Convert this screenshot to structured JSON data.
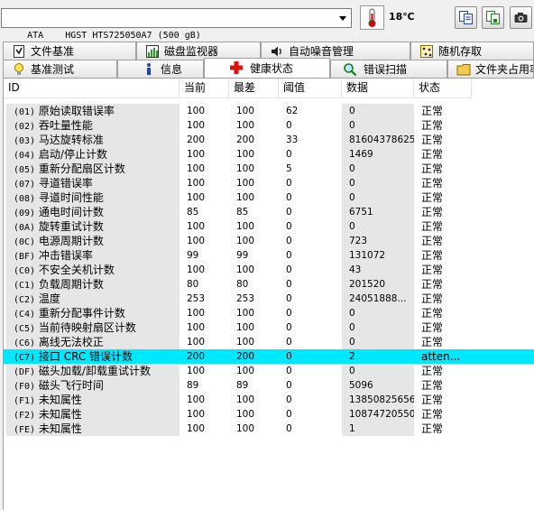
{
  "toolbar": {
    "drive": "ATA    HGST HTS725050A7 (500 gB)",
    "temperature": "18℃"
  },
  "tabs_row1": [
    {
      "label": "文件基准",
      "icon": "file-benchmark-icon"
    },
    {
      "label": "磁盘监视器",
      "icon": "disk-monitor-icon"
    },
    {
      "label": "自动噪音管理",
      "icon": "speaker-icon"
    },
    {
      "label": "随机存取",
      "icon": "random-access-icon"
    }
  ],
  "tabs_row2": [
    {
      "label": "基准测试",
      "icon": "lightbulb-icon"
    },
    {
      "label": "信息",
      "icon": "info-icon"
    },
    {
      "label": "健康状态",
      "icon": "red-cross-icon",
      "active": true
    },
    {
      "label": "错误扫描",
      "icon": "magnifier-icon"
    },
    {
      "label": "文件夹占用率",
      "icon": "folder-icon"
    }
  ],
  "table": {
    "headers": [
      "ID",
      "当前",
      "最差",
      "阈值",
      "数据",
      "状态"
    ],
    "selected_row": 17,
    "rows": [
      {
        "id": "(01)",
        "name": "原始读取错误率",
        "cur": "100",
        "worst": "100",
        "thresh": "62",
        "data": "0",
        "status": "正常"
      },
      {
        "id": "(02)",
        "name": "吞吐量性能",
        "cur": "100",
        "worst": "100",
        "thresh": "0",
        "data": "0",
        "status": "正常"
      },
      {
        "id": "(03)",
        "name": "马达旋转标准",
        "cur": "200",
        "worst": "200",
        "thresh": "33",
        "data": "81604378625",
        "status": "正常"
      },
      {
        "id": "(04)",
        "name": "启动/停止计数",
        "cur": "100",
        "worst": "100",
        "thresh": "0",
        "data": "1469",
        "status": "正常"
      },
      {
        "id": "(05)",
        "name": "重新分配扇区计数",
        "cur": "100",
        "worst": "100",
        "thresh": "5",
        "data": "0",
        "status": "正常"
      },
      {
        "id": "(07)",
        "name": "寻道错误率",
        "cur": "100",
        "worst": "100",
        "thresh": "0",
        "data": "0",
        "status": "正常"
      },
      {
        "id": "(08)",
        "name": "寻道时间性能",
        "cur": "100",
        "worst": "100",
        "thresh": "0",
        "data": "0",
        "status": "正常"
      },
      {
        "id": "(09)",
        "name": "通电时间计数",
        "cur": "85",
        "worst": "85",
        "thresh": "0",
        "data": "6751",
        "status": "正常"
      },
      {
        "id": "(0A)",
        "name": "旋转重试计数",
        "cur": "100",
        "worst": "100",
        "thresh": "0",
        "data": "0",
        "status": "正常"
      },
      {
        "id": "(0C)",
        "name": "电源周期计数",
        "cur": "100",
        "worst": "100",
        "thresh": "0",
        "data": "723",
        "status": "正常"
      },
      {
        "id": "(BF)",
        "name": "冲击错误率",
        "cur": "99",
        "worst": "99",
        "thresh": "0",
        "data": "131072",
        "status": "正常"
      },
      {
        "id": "(C0)",
        "name": "不安全关机计数",
        "cur": "100",
        "worst": "100",
        "thresh": "0",
        "data": "43",
        "status": "正常"
      },
      {
        "id": "(C1)",
        "name": "负载周期计数",
        "cur": "80",
        "worst": "80",
        "thresh": "0",
        "data": "201520",
        "status": "正常"
      },
      {
        "id": "(C2)",
        "name": "温度",
        "cur": "253",
        "worst": "253",
        "thresh": "0",
        "data": "24051888...",
        "status": "正常"
      },
      {
        "id": "(C4)",
        "name": "重新分配事件计数",
        "cur": "100",
        "worst": "100",
        "thresh": "0",
        "data": "0",
        "status": "正常"
      },
      {
        "id": "(C5)",
        "name": "当前待映射扇区计数",
        "cur": "100",
        "worst": "100",
        "thresh": "0",
        "data": "0",
        "status": "正常"
      },
      {
        "id": "(C6)",
        "name": "离线无法校正",
        "cur": "100",
        "worst": "100",
        "thresh": "0",
        "data": "0",
        "status": "正常"
      },
      {
        "id": "(C7)",
        "name": "接口 CRC 错误计数",
        "cur": "200",
        "worst": "200",
        "thresh": "0",
        "data": "2",
        "status": "atten..."
      },
      {
        "id": "(DF)",
        "name": "磁头加载/卸载重试计数",
        "cur": "100",
        "worst": "100",
        "thresh": "0",
        "data": "0",
        "status": "正常"
      },
      {
        "id": "(F0)",
        "name": "磁头飞行时间",
        "cur": "89",
        "worst": "89",
        "thresh": "0",
        "data": "5096",
        "status": "正常"
      },
      {
        "id": "(F1)",
        "name": "未知属性",
        "cur": "100",
        "worst": "100",
        "thresh": "0",
        "data": "13850825656",
        "status": "正常"
      },
      {
        "id": "(F2)",
        "name": "未知属性",
        "cur": "100",
        "worst": "100",
        "thresh": "0",
        "data": "10874720550",
        "status": "正常"
      },
      {
        "id": "(FE)",
        "name": "未知属性",
        "cur": "100",
        "worst": "100",
        "thresh": "0",
        "data": "1",
        "status": "正常"
      }
    ]
  },
  "colors": {
    "selected_row": "#00e8ff",
    "panel_bg": "#ffffff",
    "shaded_column": "#e6e6e6"
  }
}
